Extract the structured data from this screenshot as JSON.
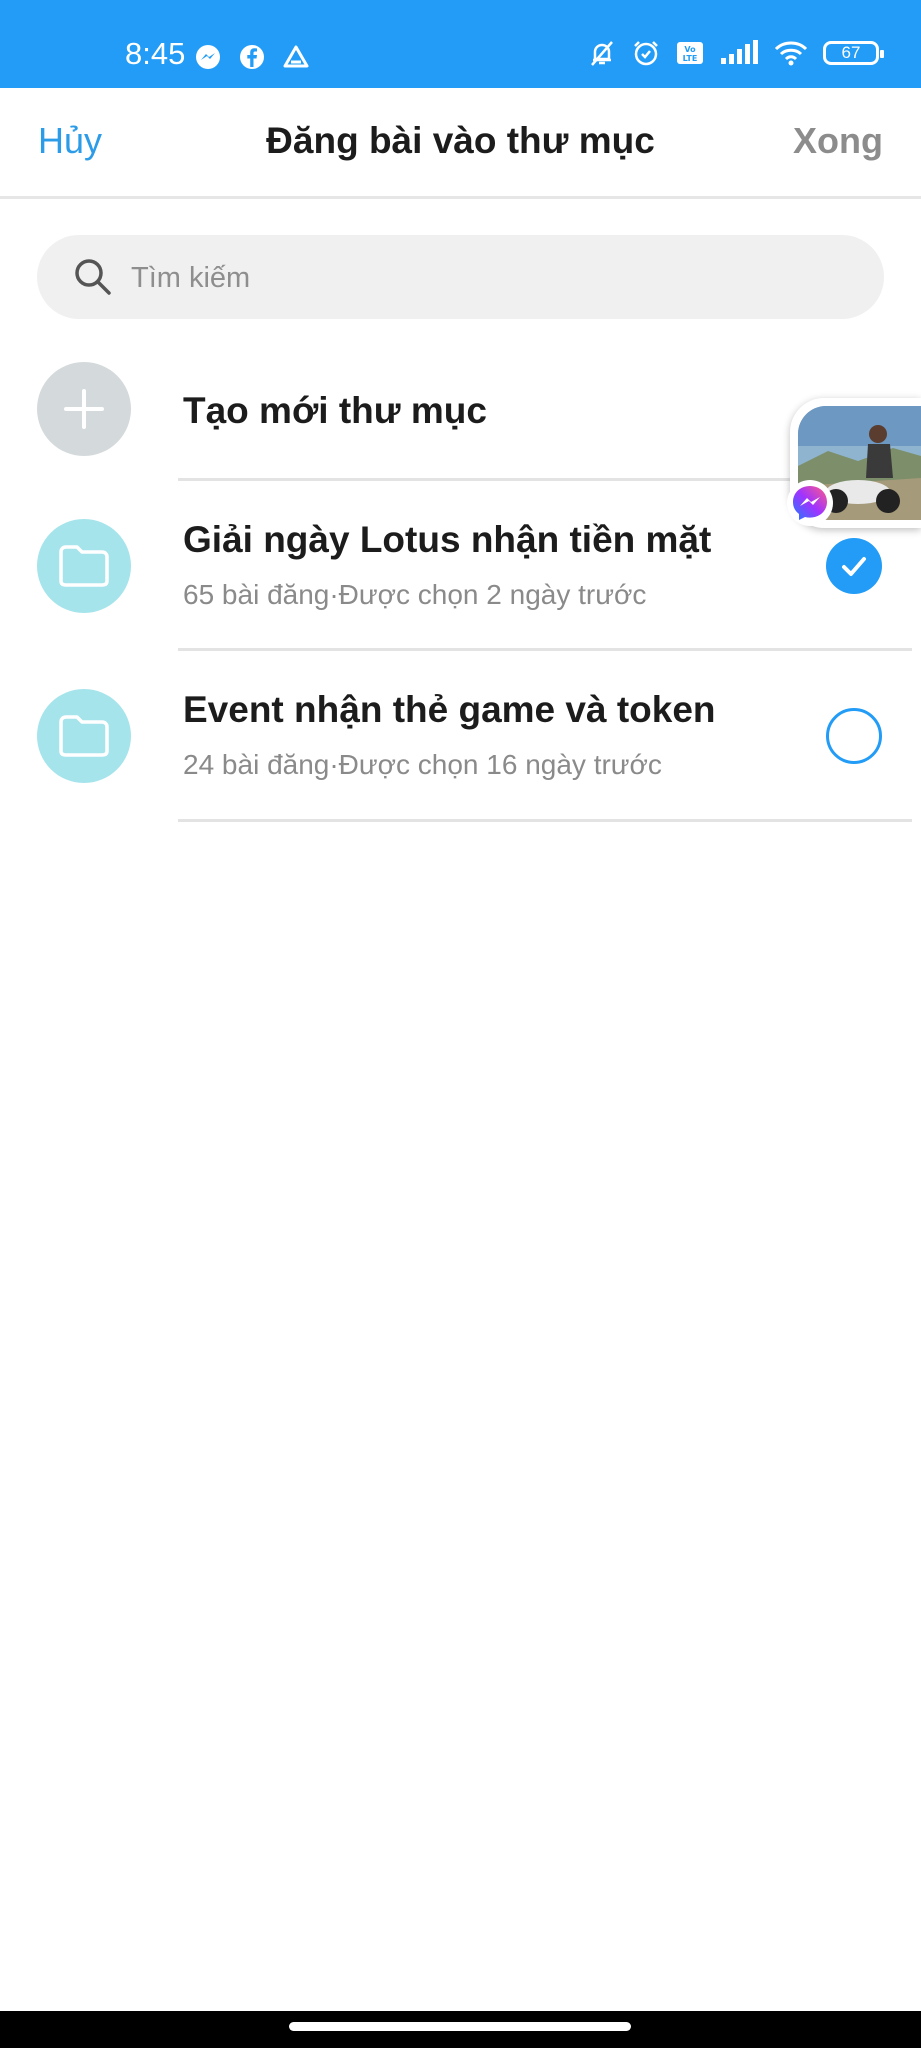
{
  "status_bar": {
    "time": "8:45",
    "left_icons": [
      "messenger-icon",
      "facebook-icon",
      "drive-icon"
    ],
    "right_icons": [
      "bell-off-icon",
      "alarm-icon",
      "volte-icon",
      "signal-icon",
      "wifi-icon"
    ],
    "battery": "67",
    "background": "#229cf6"
  },
  "header": {
    "cancel_label": "Hủy",
    "title": "Đăng bài vào thư mục",
    "done_label": "Xong"
  },
  "search": {
    "placeholder": "Tìm kiếm",
    "value": ""
  },
  "create_folder": {
    "label": "Tạo mới thư mục",
    "icon": "plus-icon"
  },
  "folders": [
    {
      "name": "Giải ngày Lotus nhận tiền mặt",
      "meta": "65 bài đăng·Được chọn 2 ngày trước",
      "selected": true
    },
    {
      "name": "Event nhận thẻ game và token",
      "meta": "24 bài đăng·Được chọn 16 ngày trước",
      "selected": false
    }
  ],
  "colors": {
    "accent": "#229cf6",
    "link": "#2d9ce8",
    "folder_circle": "#a6e4ec",
    "create_circle": "#d4d9db"
  }
}
